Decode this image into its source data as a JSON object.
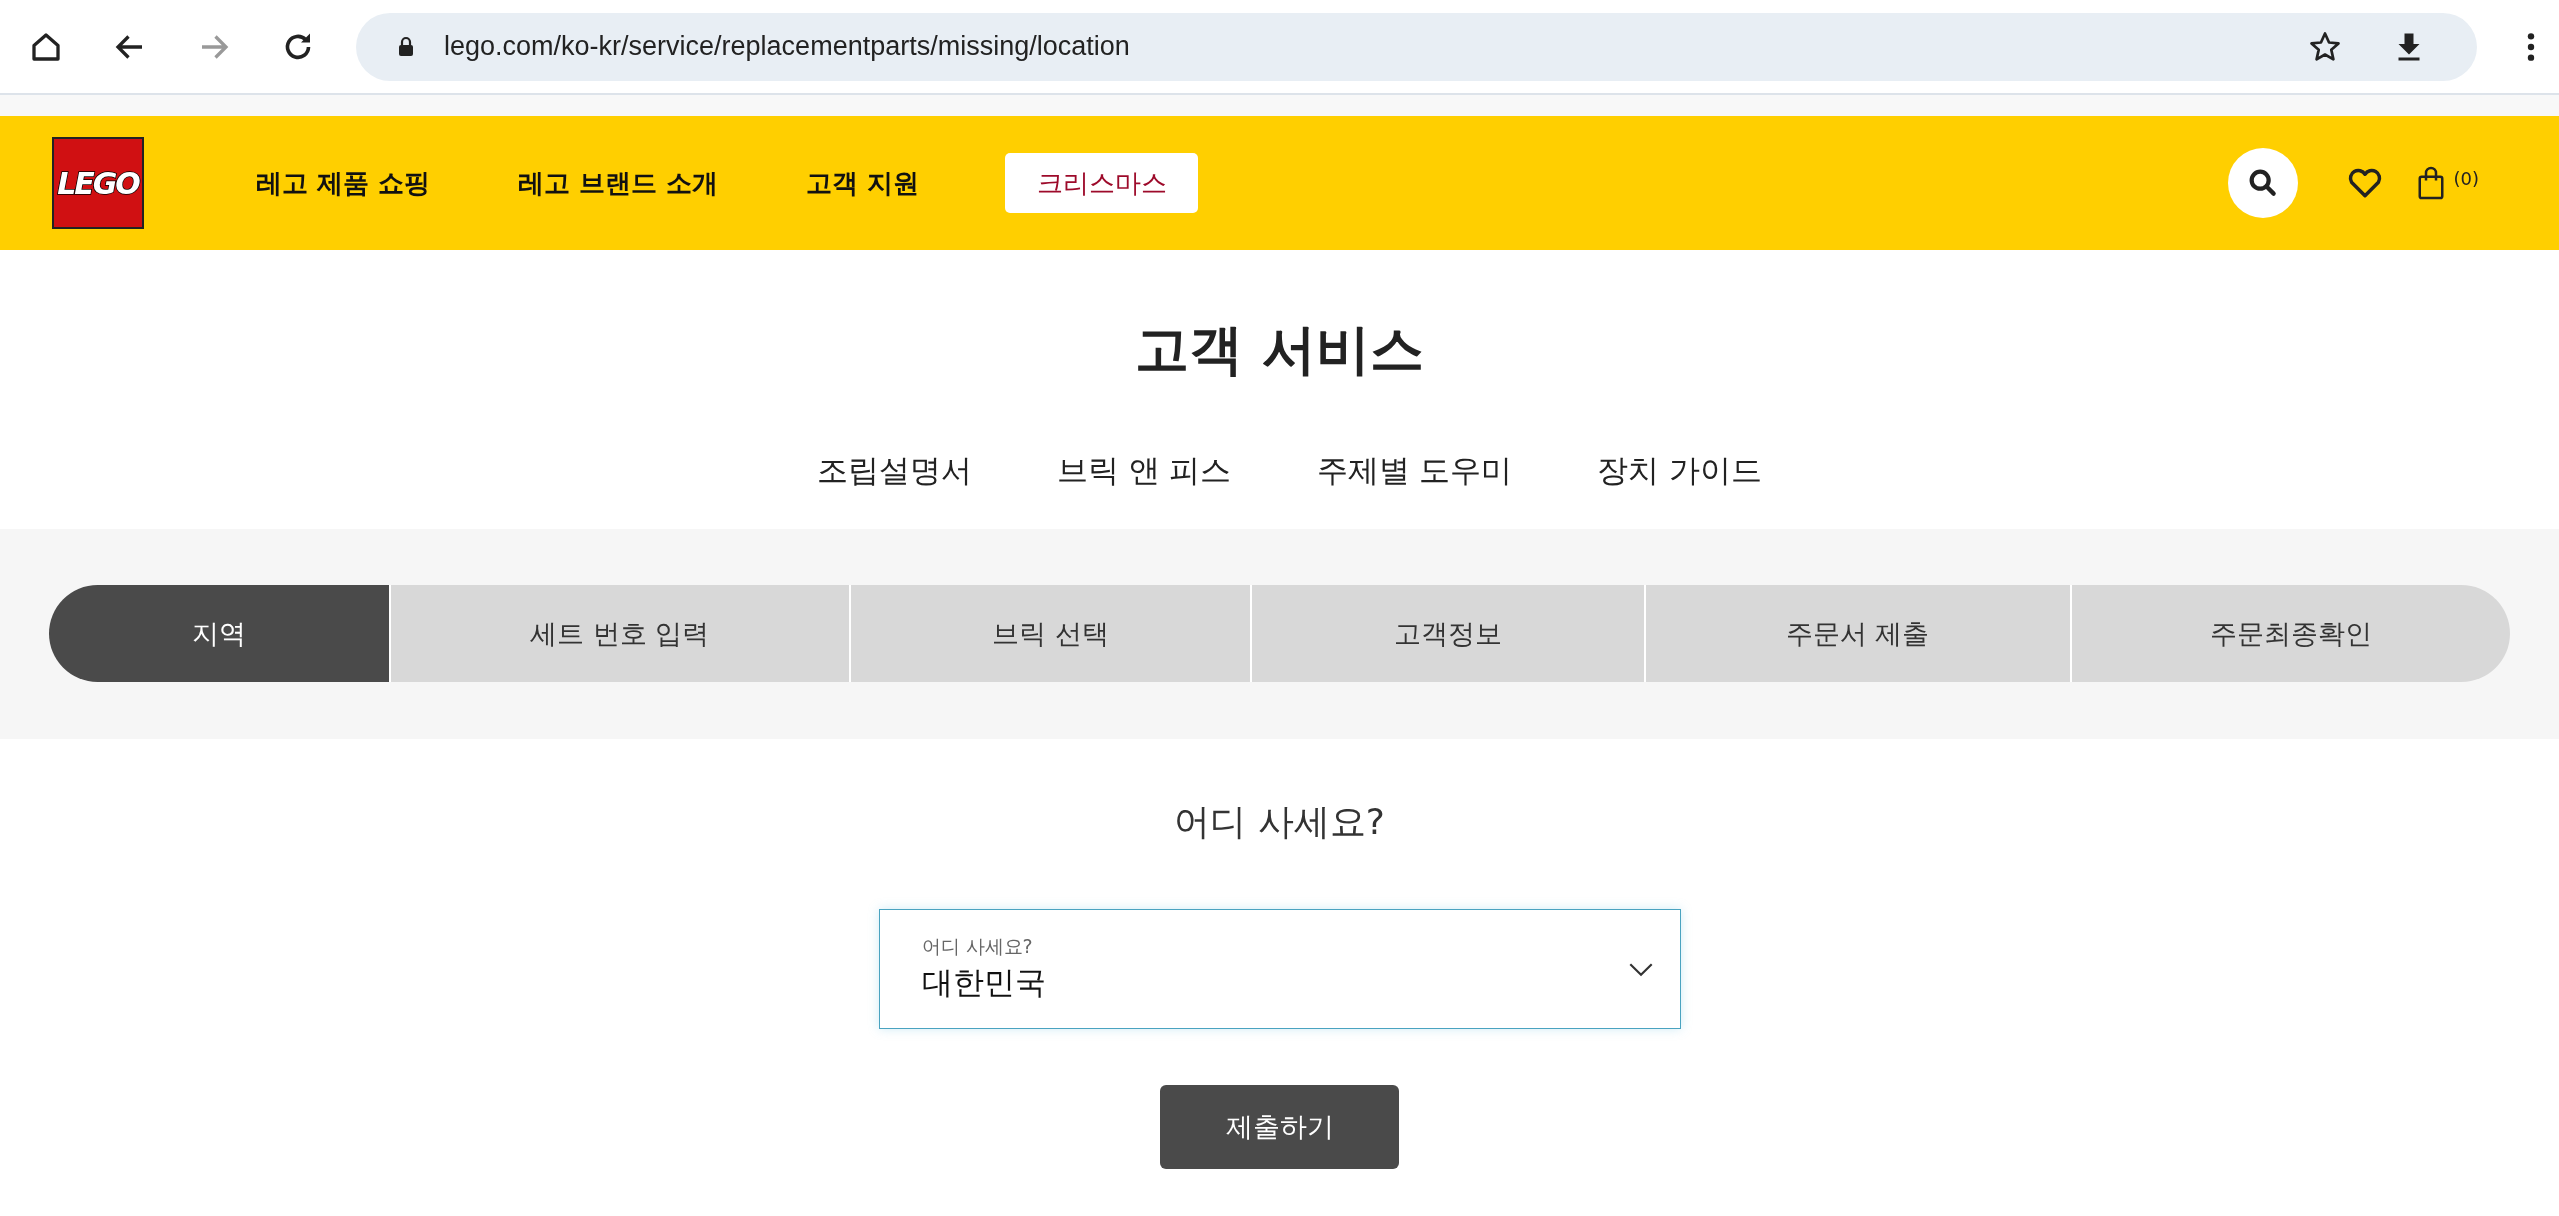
{
  "browser": {
    "url": "lego.com/ko-kr/service/replacementparts/missing/location",
    "forward_disabled": true
  },
  "header": {
    "logo": "LEGO",
    "nav": [
      {
        "label": "레고 제품 쇼핑",
        "kind": "link"
      },
      {
        "label": "레고 브랜드 소개",
        "kind": "link"
      },
      {
        "label": "고객 지원",
        "kind": "link"
      },
      {
        "label": "크리스마스",
        "kind": "button"
      }
    ],
    "cart_count": "(0)"
  },
  "page_title": "고객 서비스",
  "subnav": [
    "조립설명서",
    "브릭 앤 피스",
    "주제별 도우미",
    "장치 가이드"
  ],
  "steps": [
    {
      "label": "지역",
      "selected": true
    },
    {
      "label": "세트 번호 입력",
      "selected": false
    },
    {
      "label": "브릭 선택",
      "selected": false
    },
    {
      "label": "고객정보",
      "selected": false
    },
    {
      "label": "주문서 제출",
      "selected": false
    },
    {
      "label": "주문최종확인",
      "selected": false
    }
  ],
  "question": "어디 사세요?",
  "select": {
    "label": "어디 사세요?",
    "value": "대한민국"
  },
  "submit": "제출하기"
}
